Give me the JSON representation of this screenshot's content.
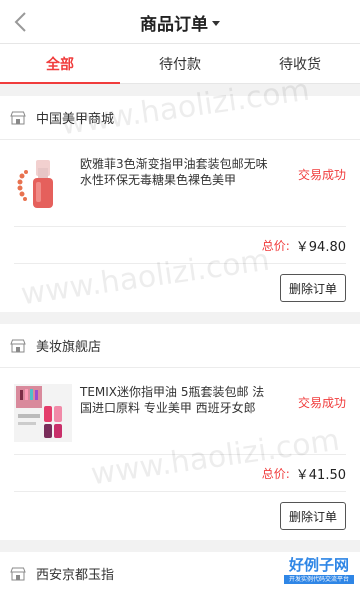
{
  "header": {
    "title": "商品订单"
  },
  "tabs": [
    {
      "label": "全部"
    },
    {
      "label": "待付款"
    },
    {
      "label": "待收货"
    }
  ],
  "orders": [
    {
      "shop": "中国美甲商城",
      "title": "欧雅菲3色渐变指甲油套装包邮无味水性环保无毒糖果色裸色美甲",
      "status": "交易成功",
      "total_label": "总价:",
      "total_value": "￥94.80",
      "action": "删除订单"
    },
    {
      "shop": "美妆旗舰店",
      "title": "TEMIX迷你指甲油 5瓶套装包邮 法国进口原料 专业美甲 西班牙女郎",
      "status": "交易成功",
      "total_label": "总价:",
      "total_value": "￥41.50",
      "action": "删除订单"
    },
    {
      "shop": "西安京都玉指"
    }
  ],
  "watermark": "www.haolizi.com",
  "brand": {
    "name": "好例子网",
    "tagline": "开发实例代码交流平台"
  },
  "colors": {
    "accent": "#f03c3c"
  }
}
